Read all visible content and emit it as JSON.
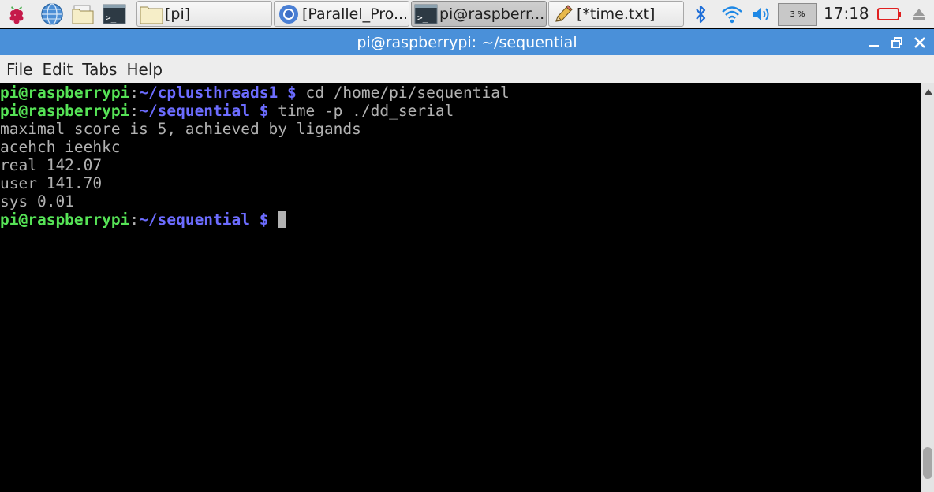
{
  "taskbar": {
    "launchers": [
      {
        "name": "raspberry-menu-icon"
      },
      {
        "name": "web-browser-icon"
      },
      {
        "name": "file-manager-icon"
      },
      {
        "name": "terminal-launcher-icon"
      }
    ],
    "tasks": [
      {
        "label": "[pi]",
        "icon": "folder-icon",
        "active": false
      },
      {
        "label": "[Parallel_Pro...",
        "icon": "chromium-icon",
        "active": false
      },
      {
        "label": "pi@raspberr...",
        "icon": "terminal-icon",
        "active": true
      },
      {
        "label": "[*time.txt]",
        "icon": "pencil-icon",
        "active": false
      }
    ],
    "cpu_usage": "3 %",
    "cpu_usage_fraction": 0.03,
    "clock": "17:18"
  },
  "window": {
    "title": "pi@raspberrypi: ~/sequential"
  },
  "menu": {
    "items": [
      "File",
      "Edit",
      "Tabs",
      "Help"
    ]
  },
  "terminal": {
    "prompt_user": "pi@raspberrypi",
    "prompt_colon": ":",
    "prompt1_path": "~/cplusthreads1 $",
    "prompt1_cmd": " cd /home/pi/sequential",
    "prompt2_path": "~/sequential $",
    "prompt2_cmd": " time -p ./dd_serial",
    "output": [
      "maximal score is 5, achieved by ligands",
      "acehch ieehkc",
      "real 142.07",
      "user 141.70",
      "sys 0.01"
    ],
    "prompt3_path": "~/sequential $"
  },
  "colors": {
    "titlebar": "#4a90d9",
    "prompt_user": "#56e356",
    "prompt_path": "#6c6cff",
    "terminal_text": "#b2b2b2",
    "terminal_bg": "#000000"
  }
}
